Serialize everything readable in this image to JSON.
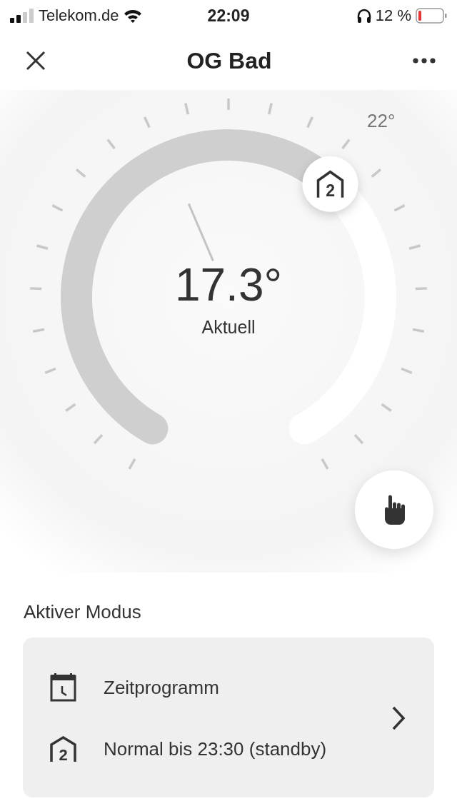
{
  "status_bar": {
    "carrier": "Telekom.de",
    "time": "22:09",
    "battery": "12 %"
  },
  "nav": {
    "title": "OG Bad"
  },
  "dial": {
    "setpoint": "22°",
    "knob_digit": "2",
    "temperature": "17.3°",
    "caption": "Aktuell"
  },
  "mode_section": {
    "heading": "Aktiver Modus",
    "rows": [
      {
        "kind": "schedule",
        "label": "Zeitprogramm"
      },
      {
        "kind": "mode",
        "digit": "2",
        "label": "Normal bis 23:30 (standby)"
      }
    ]
  }
}
